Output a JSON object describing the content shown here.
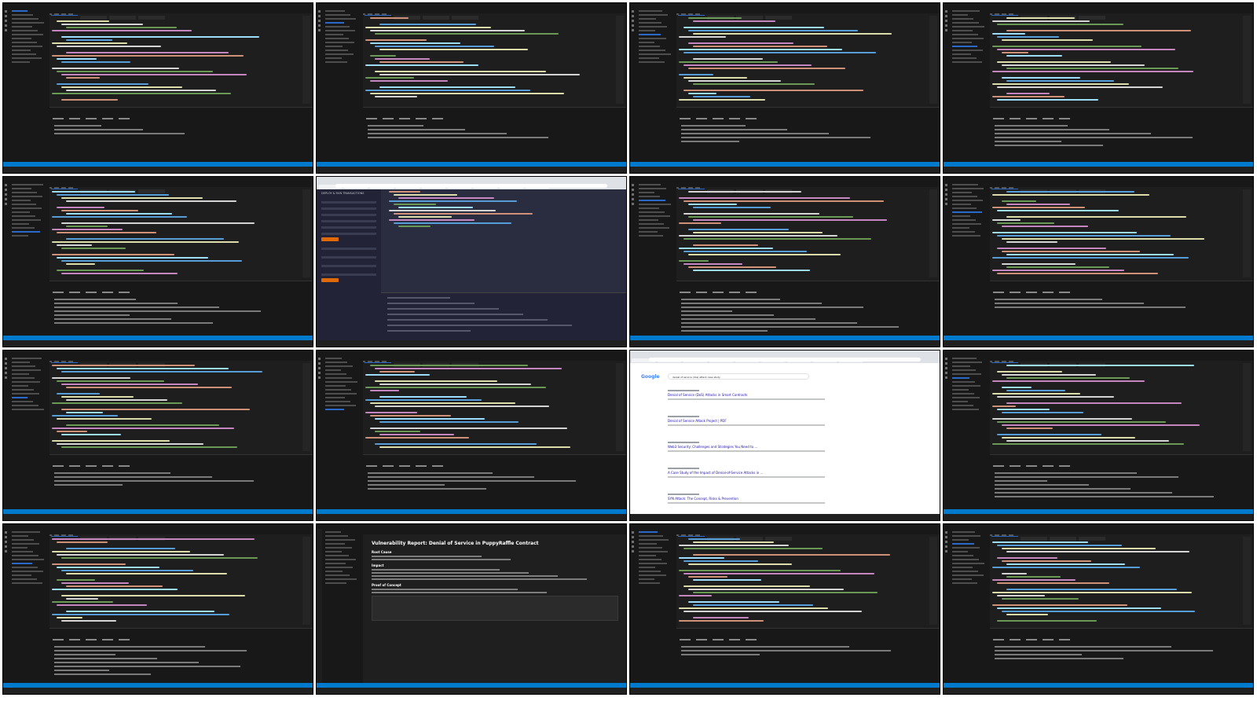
{
  "layout": "4x4 grid of screen-capture thumbnails",
  "tiles": [
    {
      "kind": "vscode",
      "tab": "PuppyRaffle.sol"
    },
    {
      "kind": "vscode",
      "tab": "PuppyRaffle.sol"
    },
    {
      "kind": "vscode",
      "tab": "PuppyRaffle.sol"
    },
    {
      "kind": "vscode",
      "tab": "PuppyRaffle.sol"
    },
    {
      "kind": "vscode",
      "tab": "PuppyRaffle.sol"
    },
    {
      "kind": "remix",
      "header": "DEPLOY & RUN TRANSACTIONS"
    },
    {
      "kind": "vscode",
      "tab": "PuppyRaffle.sol"
    },
    {
      "kind": "vscode",
      "tab": "PuppyRaffle.sol"
    },
    {
      "kind": "vscode",
      "tab": "PuppyRaffle.sol"
    },
    {
      "kind": "vscode",
      "tab": "PuppyRaffle.sol"
    },
    {
      "kind": "google",
      "query": "denial of service (dos) attack case study",
      "results": [
        {
          "title": "Denial of Service (DoS) Attacks in Smart Contracts"
        },
        {
          "title": "Denial of Service Attack Project | PDF"
        },
        {
          "title": "Web3 Security: Challenges and Strategies You Need to ..."
        },
        {
          "title": "A Case Study of the Impact of Denial-of-Service Attacks in ..."
        },
        {
          "title": "SYN Attack: The Concept, Risks & Prevention"
        }
      ]
    },
    {
      "kind": "vscode",
      "tab": "PuppyRaffle.sol"
    },
    {
      "kind": "vscode",
      "tab": "PuppyRaffle.sol"
    },
    {
      "kind": "report",
      "title": "Vulnerability Report: Denial of Service in PuppyRaffle Contract",
      "sections": [
        "Root Cause",
        "Impact",
        "Proof of Concept"
      ]
    },
    {
      "kind": "vscode",
      "tab": "PuppyRaffle.sol"
    },
    {
      "kind": "vscode",
      "tab": "PuppyRaffle.sol"
    }
  ],
  "colors": {
    "editor_bg": "#1e1e1e",
    "status_bar": "#007acc",
    "keyword": "#569cd6",
    "string": "#ce9178",
    "comment": "#6a9955"
  }
}
